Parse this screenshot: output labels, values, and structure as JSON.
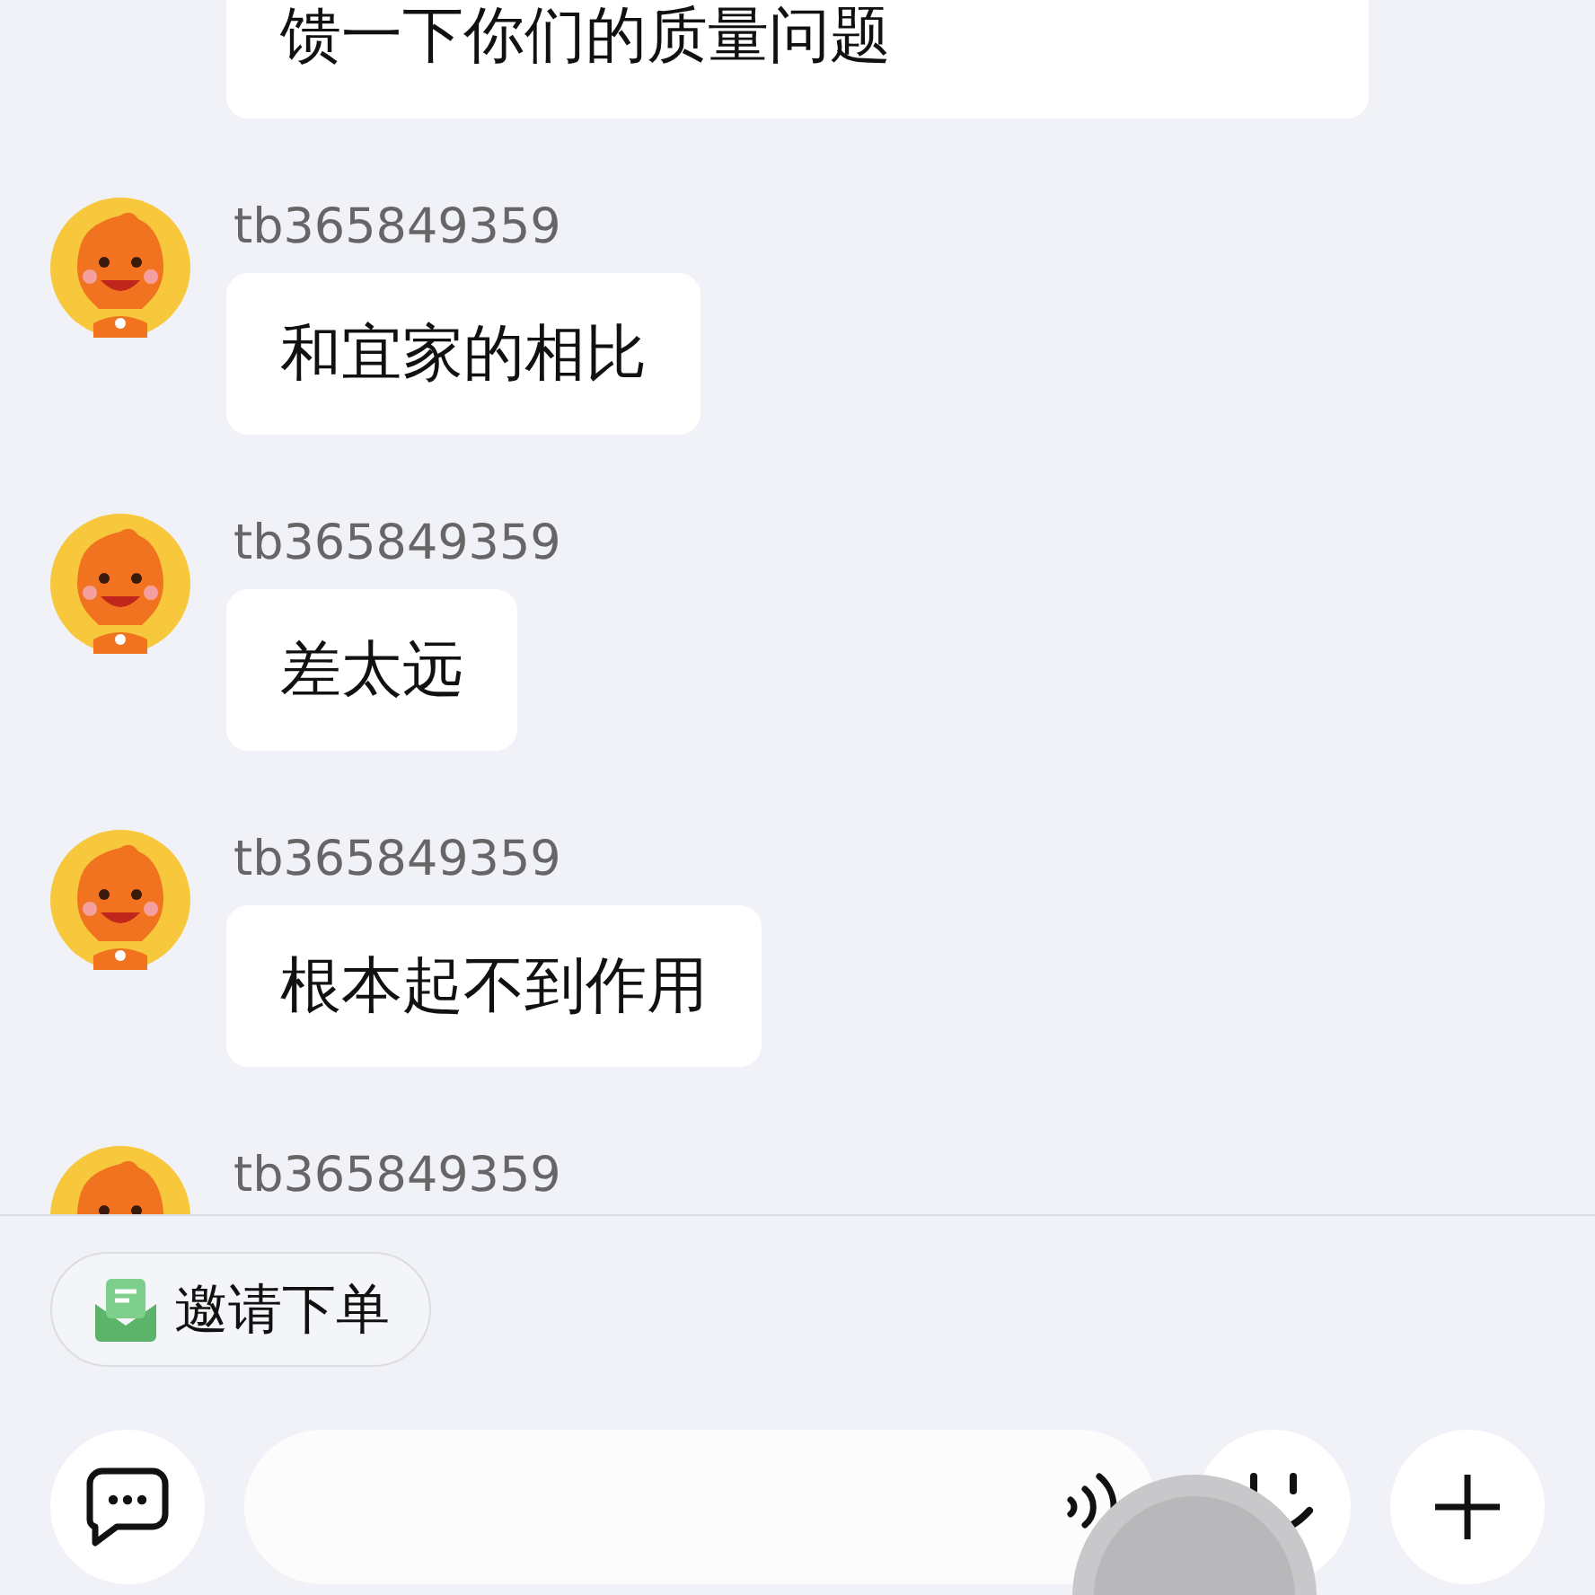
{
  "messages": [
    {
      "text": "馈一下你们的质量问题"
    },
    {
      "sender": "tb365849359",
      "text": "和宜家的相比"
    },
    {
      "sender": "tb365849359",
      "text": "差太远"
    },
    {
      "sender": "tb365849359",
      "text": "根本起不到作用"
    },
    {
      "sender": "tb365849359"
    }
  ],
  "quick_action": {
    "label": "邀请下单"
  }
}
